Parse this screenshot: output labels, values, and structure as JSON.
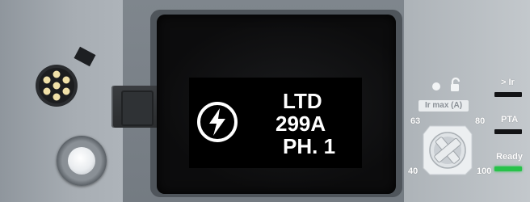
{
  "display": {
    "icon": "lightning-bolt-icon",
    "line1": "LTD",
    "line2": "299A",
    "line3": "PH. 1"
  },
  "controls": {
    "connector_icon": "test-port-connector-icon",
    "button_icon": "push-button-icon"
  },
  "dial": {
    "title": "Ir max (A)",
    "dot_icon": "dot-icon",
    "lock_icon": "unlocked-padlock-icon",
    "scale_63": "63",
    "scale_80": "80",
    "scale_40": "40",
    "scale_100": "100"
  },
  "indicators": {
    "overload_label": "> Ir",
    "pta_label": "PTA",
    "ready_label": "Ready",
    "ready_color": "#27c24a"
  }
}
